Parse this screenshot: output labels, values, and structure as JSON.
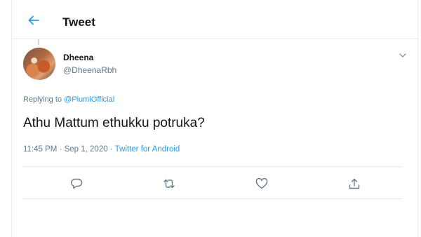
{
  "header": {
    "title": "Tweet",
    "back_icon": "arrow-left-icon"
  },
  "tweet": {
    "author": {
      "name": "Dheena",
      "handle": "@DheenaRbh"
    },
    "replying": {
      "prefix": "Replying to ",
      "handle": "@PiumiOfficial"
    },
    "text": "Athu Mattum ethukku potruka?",
    "time": "11:45 PM · Sep 1, 2020 · ",
    "source": "Twitter for Android"
  },
  "actions": [
    {
      "name": "reply",
      "icon": "reply-icon"
    },
    {
      "name": "retweet",
      "icon": "retweet-icon"
    },
    {
      "name": "like",
      "icon": "heart-icon"
    },
    {
      "name": "share",
      "icon": "share-icon"
    }
  ],
  "colors": {
    "accent": "#1da1f2",
    "muted": "#657786",
    "border": "#e6ecf0"
  }
}
